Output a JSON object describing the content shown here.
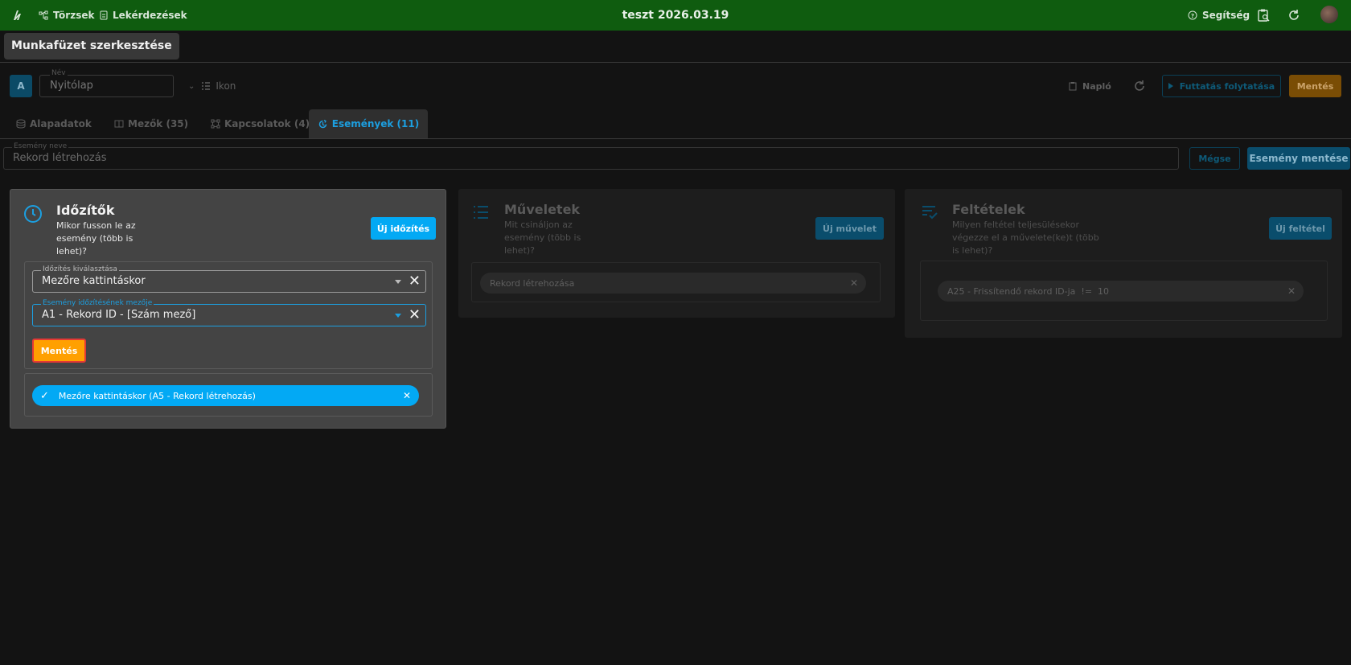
{
  "topbar": {
    "nav_items": [
      {
        "label": "Törzsek",
        "icon": "tree-icon"
      },
      {
        "label": "Lekérdezések",
        "icon": "document-icon"
      }
    ],
    "title": "teszt 2026.03.19",
    "help_label": "Segítség"
  },
  "header": {
    "page_title": "Munkafüzet szerkesztése",
    "avatar_letter": "A",
    "name_label": "Név",
    "name_value": "Nyitólap",
    "icon_label": "Ikon",
    "log_label": "Napló",
    "run_label": "Futtatás folytatása",
    "save_label": "Mentés"
  },
  "tabs": [
    {
      "label": "Alapadatok",
      "icon": "database-icon",
      "active": false
    },
    {
      "label": "Mezők (35)",
      "icon": "fields-icon",
      "active": false
    },
    {
      "label": "Kapcsolatok (4)",
      "icon": "relations-icon",
      "active": false
    },
    {
      "label": "Események (11)",
      "icon": "events-icon",
      "active": true
    }
  ],
  "event": {
    "name_label": "Esemény neve",
    "name_value": "Rekord létrehozás",
    "cancel_label": "Mégse",
    "save_label": "Esemény mentése"
  },
  "timers": {
    "title": "Időzítők",
    "subtitle_lines": [
      "Mikor fusson le az",
      "esemény (több is",
      "lehet)?"
    ],
    "new_label": "Új időzítés",
    "select_timing_label": "Időzítés kiválasztása",
    "select_timing_value": "Mezőre kattintáskor",
    "select_field_label": "Esemény időzítésének mezője",
    "select_field_value": "A1 - Rekord ID - [Szám mező]",
    "save_label": "Mentés",
    "chip_label": "Mezőre kattintáskor  (A5 - Rekord létrehozás)"
  },
  "operations": {
    "title": "Műveletek",
    "subtitle_lines": [
      "Mit csináljon az",
      "esemény (több is",
      "lehet)?"
    ],
    "new_label": "Új művelet",
    "chip_label": "Rekord létrehozása"
  },
  "conditions": {
    "title": "Feltételek",
    "subtitle_lines": [
      "Milyen feltétel teljesülésekor",
      "végezze el a művelete(ke)t (több",
      "is lehet)?"
    ],
    "new_label": "Új feltétel",
    "chip_label": "A25 - Frissítendő rekord ID-ja  !=  10"
  },
  "colors": {
    "topbar_bg": "#0f5c0f",
    "accent_blue": "#1c9fe0",
    "accent_orange": "#ffa000",
    "highlight_red": "#e53935"
  }
}
